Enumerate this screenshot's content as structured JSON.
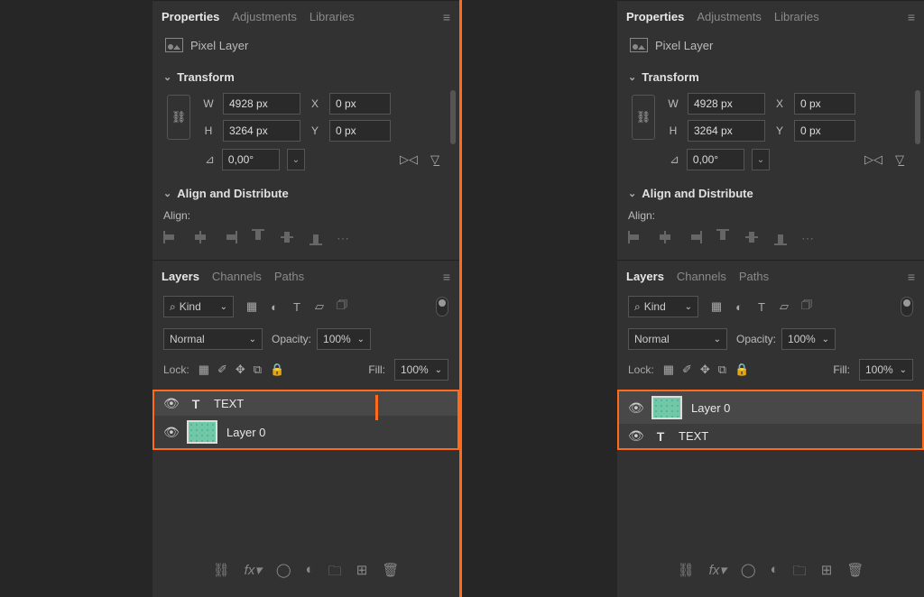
{
  "panels": {
    "properties": {
      "tabs": [
        "Properties",
        "Adjustments",
        "Libraries"
      ],
      "activeTab": 0,
      "layerType": "Pixel Layer",
      "transform": {
        "title": "Transform",
        "W": "4928 px",
        "H": "3264 px",
        "X": "0 px",
        "Y": "0 px",
        "rotation": "0,00°"
      },
      "alignDistribute": {
        "title": "Align and Distribute",
        "alignLabel": "Align:"
      }
    },
    "layers": {
      "tabs": [
        "Layers",
        "Channels",
        "Paths"
      ],
      "activeTab": 0,
      "kindLabel": "Kind",
      "blendMode": "Normal",
      "opacityLabel": "Opacity:",
      "opacityValue": "100%",
      "lockLabel": "Lock:",
      "fillLabel": "Fill:",
      "fillValue": "100%"
    }
  },
  "leftLayers": [
    {
      "kind": "text",
      "name": "TEXT"
    },
    {
      "kind": "pixel",
      "name": "Layer 0"
    }
  ],
  "rightLayers": [
    {
      "kind": "pixel",
      "name": "Layer 0"
    },
    {
      "kind": "text",
      "name": "TEXT"
    }
  ],
  "labels": {
    "W": "W",
    "H": "H",
    "X": "X",
    "Y": "Y",
    "searchGlyph": "⌕"
  }
}
